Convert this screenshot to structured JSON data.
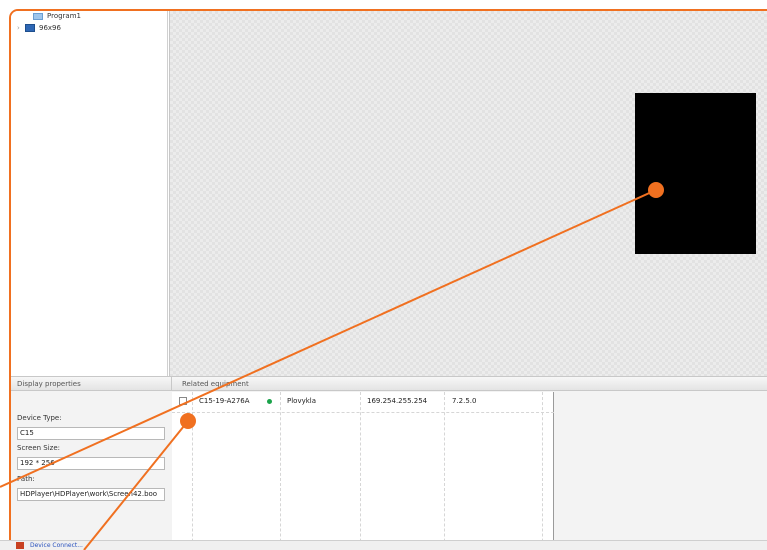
{
  "tree": {
    "program_label": "Program1",
    "screen_label": "96x96",
    "twisty": "›"
  },
  "panels": {
    "display_properties_title": "Display properties",
    "related_equipment_title": "Related equipment"
  },
  "display_properties": {
    "device_type_label": "Device Type:",
    "device_type_value": "C15",
    "screen_size_label": "Screen Size:",
    "screen_size_value": "192 * 256",
    "path_label": "Path:",
    "path_value": "HDPlayer\\HDPlayer\\work\\Screen42.boo"
  },
  "equipment": {
    "rows": [
      {
        "device_id": "C15-19-A276A",
        "status": "online",
        "name": "Plovykla",
        "ip": "169.254.255.254",
        "version": "7.2.5.0",
        "checked": false
      }
    ]
  },
  "statusbar": {
    "text": "Device Connect..."
  },
  "colors": {
    "accent": "#f07020",
    "status_online": "#1aa34a",
    "preview": "#000000"
  }
}
